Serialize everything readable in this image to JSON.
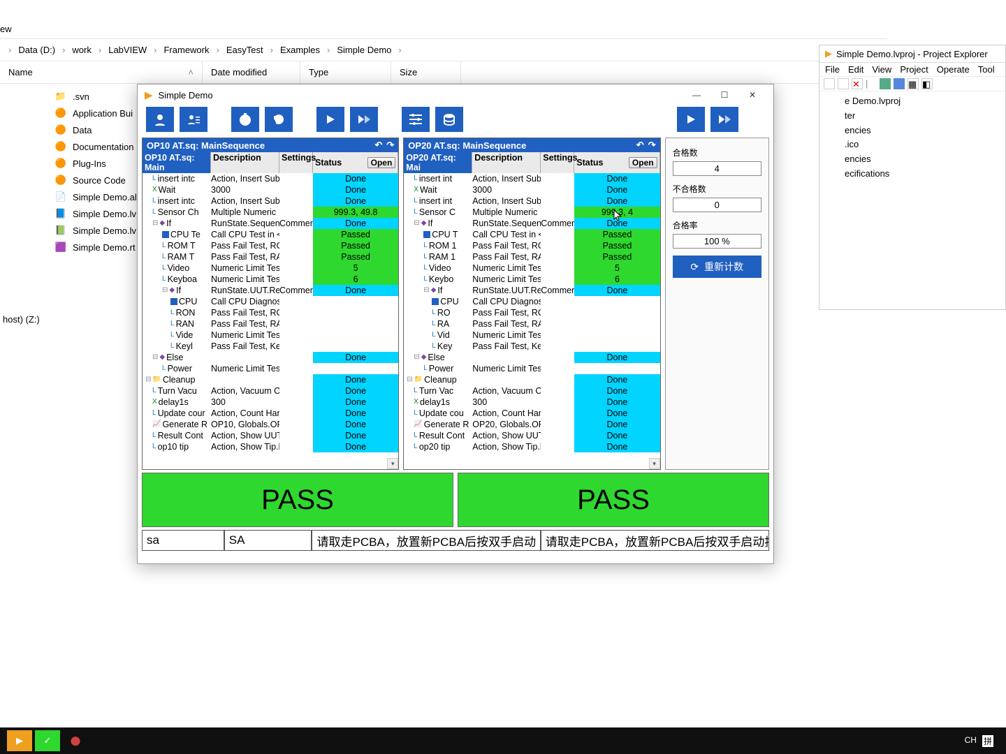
{
  "explorer": {
    "tab": "ew",
    "breadcrumb": [
      "Data (D:)",
      "work",
      "LabVIEW",
      "Framework",
      "EasyTest",
      "Examples",
      "Simple Demo"
    ],
    "columns": [
      "Name",
      "Date modified",
      "Type",
      "Size"
    ],
    "sort_icon": true,
    "files": [
      {
        "icon": "folder",
        "name": ".svn"
      },
      {
        "icon": "app",
        "name": "Application Bui"
      },
      {
        "icon": "app",
        "name": "Data"
      },
      {
        "icon": "app",
        "name": "Documentation"
      },
      {
        "icon": "app",
        "name": "Plug-Ins"
      },
      {
        "icon": "app",
        "name": "Source Code"
      },
      {
        "icon": "alias",
        "name": "Simple Demo.al"
      },
      {
        "icon": "lvlps",
        "name": "Simple Demo.lv"
      },
      {
        "icon": "lvproj",
        "name": "Simple Demo.lv"
      },
      {
        "icon": "rtm",
        "name": "Simple Demo.rt"
      }
    ],
    "host": "host) (Z:)"
  },
  "proj": {
    "title": "Simple Demo.lvproj - Project Explorer",
    "menu": [
      "File",
      "Edit",
      "View",
      "Project",
      "Operate",
      "Tool"
    ],
    "items": [
      "e Demo.lvproj",
      "ter",
      "encies",
      ".ico",
      "encies",
      "ecifications"
    ]
  },
  "app": {
    "title": "Simple Demo",
    "stats": {
      "pass_label": "合格数",
      "pass": "4",
      "fail_label": "不合格数",
      "fail": "0",
      "rate_label": "合格率",
      "rate": "100 %",
      "reset": "重新计数"
    },
    "seq": [
      {
        "title": "OP10 AT.sq: MainSequence",
        "tab": "OP10 AT.sq: Main",
        "open": "Open ",
        "cols": [
          "Description",
          "Settings",
          "Status"
        ],
        "rows": [
          {
            "ind": 1,
            "ic": "L",
            "name": "insert intc",
            "desc": "Action, Insert Subp",
            "set": "",
            "stat": "Done",
            "cls": "cyan"
          },
          {
            "ind": 1,
            "ic": "X",
            "name": "Wait",
            "desc": "3000",
            "set": "",
            "stat": "Done",
            "cls": "cyan"
          },
          {
            "ind": 1,
            "ic": "L",
            "name": "insert intc",
            "desc": "Action, Insert Subp",
            "set": "",
            "stat": "Done",
            "cls": "cyan"
          },
          {
            "ind": 1,
            "ic": "L",
            "name": "Sensor Ch",
            "desc": "Multiple Numeric",
            "set": "",
            "stat": "999.3, 49.8",
            "cls": "green"
          },
          {
            "ind": 1,
            "ic": "q",
            "tree": "⊟",
            "name": "If",
            "desc": "RunState.Sequenc",
            "set": "Commer",
            "stat": "Done",
            "cls": "cyan"
          },
          {
            "ind": 2,
            "ic": "box",
            "name": "CPU Te",
            "desc": "Call CPU Test in <",
            "set": "",
            "stat": "Passed",
            "cls": "green"
          },
          {
            "ind": 2,
            "ic": "L",
            "name": "ROM T",
            "desc": "Pass Fail Test, RO",
            "set": "",
            "stat": "Passed",
            "cls": "green"
          },
          {
            "ind": 2,
            "ic": "L",
            "name": "RAM T",
            "desc": "Pass Fail Test, RA",
            "set": "",
            "stat": "Passed",
            "cls": "green"
          },
          {
            "ind": 2,
            "ic": "L",
            "name": "Video",
            "desc": "Numeric Limit Tes",
            "set": "",
            "stat": "5",
            "cls": "green"
          },
          {
            "ind": 2,
            "ic": "L",
            "name": "Keyboa",
            "desc": "Numeric Limit Tes",
            "set": "",
            "stat": "6",
            "cls": "green"
          },
          {
            "ind": 2,
            "ic": "q",
            "tree": "⊟",
            "name": "If",
            "desc": "RunState.UUT.Res",
            "set": "Commer",
            "stat": "Done",
            "cls": "cyan"
          },
          {
            "ind": 3,
            "ic": "box",
            "name": "CPU",
            "desc": "Call CPU Diagnos",
            "set": "",
            "stat": "",
            "cls": ""
          },
          {
            "ind": 3,
            "ic": "L",
            "name": "RON",
            "desc": "Pass Fail Test, RO",
            "set": "",
            "stat": "",
            "cls": ""
          },
          {
            "ind": 3,
            "ic": "L",
            "name": "RAN",
            "desc": "Pass Fail Test, RA",
            "set": "",
            "stat": "",
            "cls": ""
          },
          {
            "ind": 3,
            "ic": "L",
            "name": "Vide",
            "desc": "Numeric Limit Tes",
            "set": "",
            "stat": "",
            "cls": ""
          },
          {
            "ind": 3,
            "ic": "L",
            "name": "Keyl",
            "desc": "Pass Fail Test, Key",
            "set": "",
            "stat": "",
            "cls": ""
          },
          {
            "ind": 1,
            "ic": "q",
            "tree": "⊟",
            "name": "Else",
            "desc": "",
            "set": "",
            "stat": "Done",
            "cls": "cyan"
          },
          {
            "ind": 2,
            "ic": "L",
            "name": "Power",
            "desc": "Numeric Limit Tes",
            "set": "",
            "stat": "",
            "cls": ""
          },
          {
            "ind": 0,
            "ic": "folder",
            "tree": "⊟",
            "name": "Cleanup",
            "desc": "",
            "set": "",
            "stat": "Done",
            "cls": "cyan"
          },
          {
            "ind": 1,
            "ic": "L",
            "name": "Turn Vacu",
            "desc": "Action, Vacuum Of",
            "set": "",
            "stat": "Done",
            "cls": "cyan"
          },
          {
            "ind": 1,
            "ic": "X",
            "name": "delay1s",
            "desc": "300",
            "set": "",
            "stat": "Done",
            "cls": "cyan"
          },
          {
            "ind": 1,
            "ic": "L",
            "name": "Update cour",
            "desc": "Action, Count Han",
            "set": "",
            "stat": "Done",
            "cls": "cyan"
          },
          {
            "ind": 1,
            "ic": "g",
            "name": "Generate R",
            "desc": "OP10, Globals.OP",
            "set": "",
            "stat": "Done",
            "cls": "cyan"
          },
          {
            "ind": 1,
            "ic": "L",
            "name": "Result Cont",
            "desc": "Action, Show UUT",
            "set": "",
            "stat": "Done",
            "cls": "cyan"
          },
          {
            "ind": 1,
            "ic": "L",
            "name": "op10 tip",
            "desc": "Action, Show Tip.l",
            "set": "",
            "stat": "Done",
            "cls": "cyan"
          }
        ]
      },
      {
        "title": "OP20 AT.sq: MainSequence",
        "tab": "OP20 AT.sq: Mai",
        "open": "Open ",
        "cols": [
          "Description",
          "Settings",
          "Status"
        ],
        "rows": [
          {
            "ind": 1,
            "ic": "L",
            "name": "insert int",
            "desc": "Action, Insert Sub",
            "set": "",
            "stat": "Done",
            "cls": "cyan"
          },
          {
            "ind": 1,
            "ic": "X",
            "name": "Wait",
            "desc": "3000",
            "set": "",
            "stat": "Done",
            "cls": "cyan"
          },
          {
            "ind": 1,
            "ic": "L",
            "name": "insert int",
            "desc": "Action, Insert Sub",
            "set": "",
            "stat": "Done",
            "cls": "cyan"
          },
          {
            "ind": 1,
            "ic": "L",
            "name": "Sensor C",
            "desc": "Multiple Numeric",
            "set": "",
            "stat": "999.3, 4",
            "cls": "green"
          },
          {
            "ind": 1,
            "ic": "q",
            "tree": "⊟",
            "name": "If",
            "desc": "RunState.Sequenc",
            "set": "Commer",
            "stat": "Done",
            "cls": "cyan"
          },
          {
            "ind": 2,
            "ic": "box",
            "name": "CPU T",
            "desc": "Call CPU Test in <",
            "set": "",
            "stat": "Passed",
            "cls": "green"
          },
          {
            "ind": 2,
            "ic": "L",
            "name": "ROM 1",
            "desc": "Pass Fail Test, RO",
            "set": "",
            "stat": "Passed",
            "cls": "green"
          },
          {
            "ind": 2,
            "ic": "L",
            "name": "RAM 1",
            "desc": "Pass Fail Test, RA",
            "set": "",
            "stat": "Passed",
            "cls": "green"
          },
          {
            "ind": 2,
            "ic": "L",
            "name": "Video",
            "desc": "Numeric Limit Tes",
            "set": "",
            "stat": "5",
            "cls": "green"
          },
          {
            "ind": 2,
            "ic": "L",
            "name": "Keybo",
            "desc": "Numeric Limit Tes",
            "set": "",
            "stat": "6",
            "cls": "green"
          },
          {
            "ind": 2,
            "ic": "q",
            "tree": "⊟",
            "name": "If",
            "desc": "RunState.UUT.Res",
            "set": "Commer",
            "stat": "Done",
            "cls": "cyan"
          },
          {
            "ind": 3,
            "ic": "box",
            "name": "CPU",
            "desc": "Call CPU Diagnos",
            "set": "",
            "stat": "",
            "cls": ""
          },
          {
            "ind": 3,
            "ic": "L",
            "name": "RO",
            "desc": "Pass Fail Test, RO",
            "set": "",
            "stat": "",
            "cls": ""
          },
          {
            "ind": 3,
            "ic": "L",
            "name": "RA",
            "desc": "Pass Fail Test, RA",
            "set": "",
            "stat": "",
            "cls": ""
          },
          {
            "ind": 3,
            "ic": "L",
            "name": "Vid",
            "desc": "Numeric Limit Tes",
            "set": "",
            "stat": "",
            "cls": ""
          },
          {
            "ind": 3,
            "ic": "L",
            "name": "Key",
            "desc": "Pass Fail Test, Key",
            "set": "",
            "stat": "",
            "cls": ""
          },
          {
            "ind": 1,
            "ic": "q",
            "tree": "⊟",
            "name": "Else",
            "desc": "",
            "set": "",
            "stat": "Done",
            "cls": "cyan"
          },
          {
            "ind": 2,
            "ic": "L",
            "name": "Power",
            "desc": "Numeric Limit Tes",
            "set": "",
            "stat": "",
            "cls": ""
          },
          {
            "ind": 0,
            "ic": "folder",
            "tree": "⊟",
            "name": "Cleanup",
            "desc": "",
            "set": "",
            "stat": "Done",
            "cls": "cyan"
          },
          {
            "ind": 1,
            "ic": "L",
            "name": "Turn Vac",
            "desc": "Action, Vacuum O",
            "set": "",
            "stat": "Done",
            "cls": "cyan"
          },
          {
            "ind": 1,
            "ic": "X",
            "name": "delay1s",
            "desc": "300",
            "set": "",
            "stat": "Done",
            "cls": "cyan"
          },
          {
            "ind": 1,
            "ic": "L",
            "name": "Update cou",
            "desc": "Action, Count Han",
            "set": "",
            "stat": "Done",
            "cls": "cyan"
          },
          {
            "ind": 1,
            "ic": "g",
            "name": "Generate R",
            "desc": "OP20, Globals.OP",
            "set": "",
            "stat": "Done",
            "cls": "cyan"
          },
          {
            "ind": 1,
            "ic": "L",
            "name": "Result Cont",
            "desc": "Action, Show UUT",
            "set": "",
            "stat": "Done",
            "cls": "cyan"
          },
          {
            "ind": 1,
            "ic": "L",
            "name": "op20 tip",
            "desc": "Action, Show Tip.l",
            "set": "",
            "stat": "Done",
            "cls": "cyan"
          }
        ]
      }
    ],
    "pass": [
      "PASS",
      "PASS"
    ],
    "bottom": [
      "sa",
      "SA",
      "请取走PCBA，放置新PCBA后按双手启动",
      "请取走PCBA，放置新PCBA后按双手启动按"
    ]
  },
  "taskbar": {
    "ime": "CH",
    "ime2": "拼"
  }
}
